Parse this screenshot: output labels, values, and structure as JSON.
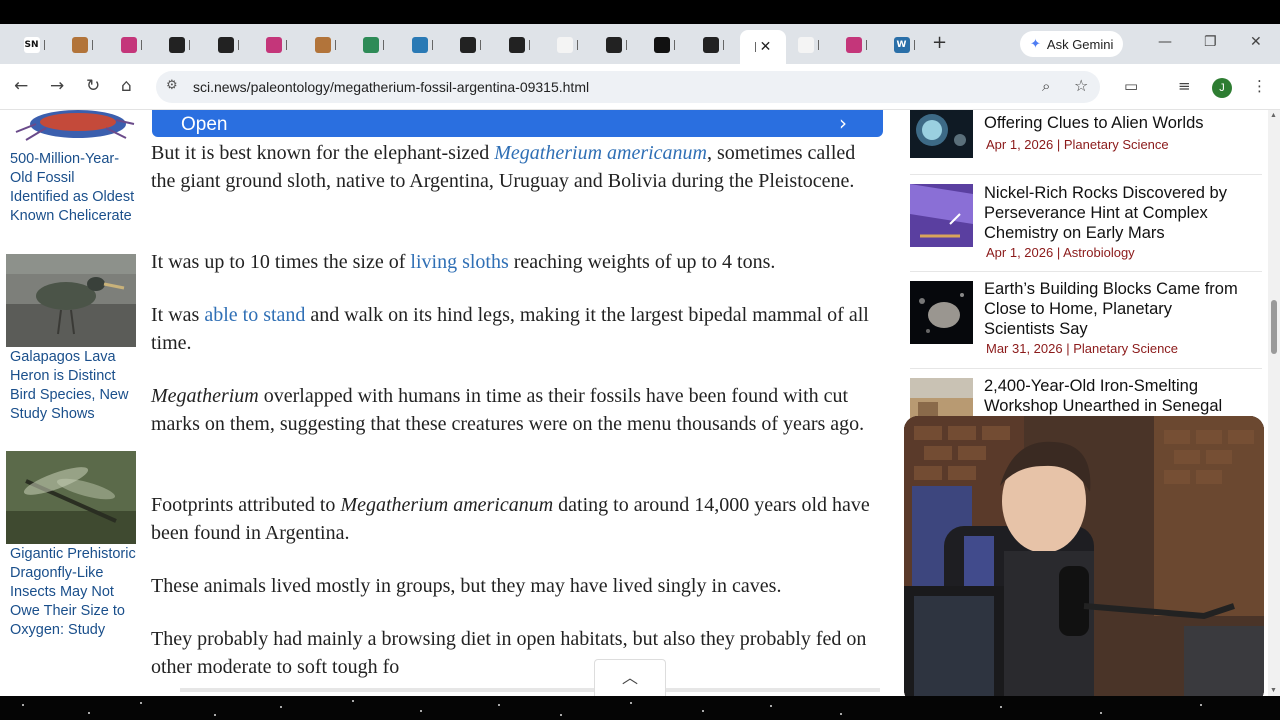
{
  "browser": {
    "tabs": [
      {
        "icon": "scinews-icon",
        "text": "SN",
        "color": "#ffffff",
        "fg": "#111111"
      },
      {
        "icon": "shield-icon",
        "text": "",
        "color": "#b2743a"
      },
      {
        "icon": "asterisk-icon",
        "text": "",
        "color": "#c4367a"
      },
      {
        "icon": "circle-icon",
        "text": "",
        "color": "#222222"
      },
      {
        "icon": "circle-icon",
        "text": "",
        "color": "#222222"
      },
      {
        "icon": "asterisk-icon",
        "text": "",
        "color": "#c4367a"
      },
      {
        "icon": "shield-icon",
        "text": "",
        "color": "#b2743a"
      },
      {
        "icon": "wikimedia-icon",
        "text": "",
        "color": "#2e8b57"
      },
      {
        "icon": "wikimedia-icon",
        "text": "",
        "color": "#2a7ab5"
      },
      {
        "icon": "circle-icon",
        "text": "",
        "color": "#222222"
      },
      {
        "icon": "circle-icon",
        "text": "",
        "color": "#222222"
      },
      {
        "icon": "blank-icon",
        "text": "",
        "color": "#f4f4f4"
      },
      {
        "icon": "circle-icon",
        "text": "",
        "color": "#222222"
      },
      {
        "icon": "hexagon-icon",
        "text": "",
        "color": "#111111"
      },
      {
        "icon": "circle-icon",
        "text": "",
        "color": "#222222"
      }
    ],
    "active_tab": {
      "close": "✕"
    },
    "tail_tabs": [
      {
        "icon": "blank-icon",
        "color": "#f4f4f4"
      },
      {
        "icon": "asterisk-icon",
        "color": "#c4367a"
      },
      {
        "icon": "wordpress-icon",
        "color": "#2a6fa8",
        "text": "W"
      }
    ],
    "new_tab": "+",
    "gemini_label": "Ask Gemini",
    "window_controls": {
      "minimize": "—",
      "restore": "❐",
      "close": "✕"
    },
    "url": "sci.news/paleontology/megatherium-fossil-argentina-09315.html",
    "profile_initial": "J"
  },
  "left_sidebar": [
    {
      "caption": "500-Million-Year-Old Fossil Identified as Oldest Known Chelicerate"
    },
    {
      "caption": "Galapagos Lava Heron is Distinct Bird Species, New Study Shows"
    },
    {
      "caption": "Gigantic Prehistoric Dragonfly-Like Insects May Not Owe Their Size to Oxygen: Study"
    }
  ],
  "open_banner": {
    "label": "Open",
    "arrow": "›"
  },
  "article": {
    "p1": {
      "pre": "But it is best known for the elephant-sized ",
      "link": "Megatherium americanum",
      "post": ", sometimes called the giant ground sloth, native to Argentina, Uruguay and Bolivia during the Pleistocene."
    },
    "p2": {
      "pre": "It was up to 10 times the size of ",
      "link": "living sloths",
      "post": " reaching weights of up to 4 tons."
    },
    "p3": {
      "pre": "It was ",
      "link": "able to stand",
      "post": " and walk on its hind legs, making it the largest bipedal mammal of all time."
    },
    "p4": {
      "italic": "Megatherium",
      "post": " overlapped with humans in time as their fossils have been found with cut marks on them, suggesting that these creatures were on the menu thousands of years ago."
    },
    "p5": {
      "pre": "Footprints attributed to ",
      "italic": "Megatherium americanum",
      "post": " dating to around 14,000 years old have been found in Argentina."
    },
    "p6": {
      "text": "These animals lived mostly in groups, but they may have lived singly in caves."
    },
    "p7": {
      "text": "They probably had mainly a browsing diet in open habitats, but also they probably fed on other moderate to soft tough fo"
    }
  },
  "collapse_arrow": "︿",
  "right_sidebar": [
    {
      "title": "Offering Clues to Alien Worlds",
      "date": "Apr 1, 2026",
      "category": "Planetary Science"
    },
    {
      "title": "Nickel-Rich Rocks Discovered by Perseverance Hint at Complex Chemistry on Early Mars",
      "date": "Apr 1, 2026",
      "category": "Astrobiology"
    },
    {
      "title": "Earth’s Building Blocks Came from Close to Home, Planetary Scientists Say",
      "date": "Mar 31, 2026",
      "category": "Planetary Science"
    },
    {
      "title": "2,400-Year-Old Iron-Smelting Workshop Unearthed in Senegal"
    }
  ],
  "meta_separator": "|"
}
